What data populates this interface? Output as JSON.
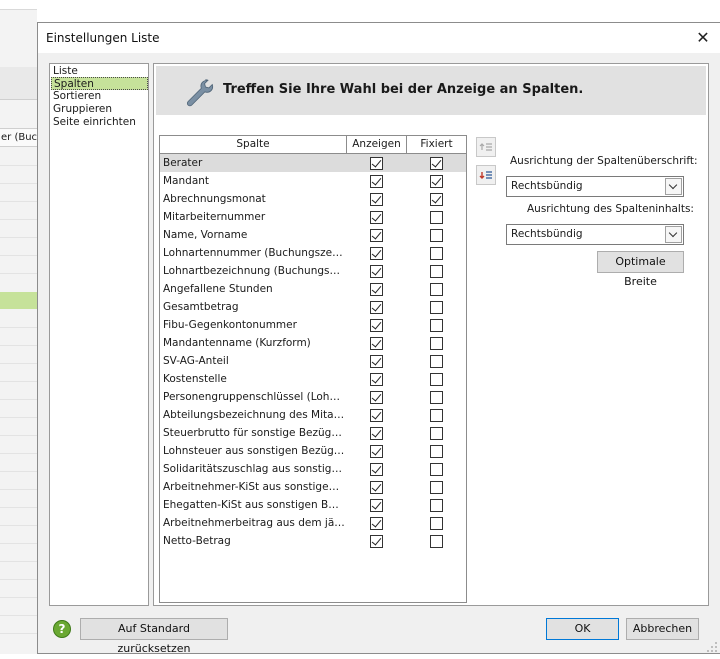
{
  "background": {
    "column_header_fragment": "er (Buc"
  },
  "dialog": {
    "title": "Einstellungen Liste",
    "close_glyph": "✕"
  },
  "nav": {
    "items": [
      {
        "label": "Liste",
        "selected": false
      },
      {
        "label": "Spalten",
        "selected": true
      },
      {
        "label": "Sortieren",
        "selected": false
      },
      {
        "label": "Gruppieren",
        "selected": false
      },
      {
        "label": "Seite einrichten",
        "selected": false
      }
    ]
  },
  "main": {
    "heading": "Treffen Sie Ihre Wahl bei der Anzeige an Spalten.",
    "icon": "wrench-icon"
  },
  "table": {
    "headers": {
      "spalte": "Spalte",
      "anzeigen": "Anzeigen",
      "fixiert": "Fixiert"
    },
    "rows": [
      {
        "name": "Berater",
        "anzeigen": true,
        "fixiert": true,
        "selected": true
      },
      {
        "name": "Mandant",
        "anzeigen": true,
        "fixiert": true
      },
      {
        "name": "Abrechnungsmonat",
        "anzeigen": true,
        "fixiert": true
      },
      {
        "name": "Mitarbeiternummer",
        "anzeigen": true,
        "fixiert": false
      },
      {
        "name": "Name, Vorname",
        "anzeigen": true,
        "fixiert": false
      },
      {
        "name": "Lohnartennummer (Buchungszeile)",
        "anzeigen": true,
        "fixiert": false
      },
      {
        "name": "Lohnartbezeichnung (Buchungszei...",
        "anzeigen": true,
        "fixiert": false
      },
      {
        "name": "Angefallene Stunden",
        "anzeigen": true,
        "fixiert": false
      },
      {
        "name": "Gesamtbetrag",
        "anzeigen": true,
        "fixiert": false
      },
      {
        "name": "Fibu-Gegenkontonummer",
        "anzeigen": true,
        "fixiert": false
      },
      {
        "name": "Mandantenname (Kurzform)",
        "anzeigen": true,
        "fixiert": false
      },
      {
        "name": "SV-AG-Anteil",
        "anzeigen": true,
        "fixiert": false
      },
      {
        "name": "Kostenstelle",
        "anzeigen": true,
        "fixiert": false
      },
      {
        "name": "Personengruppenschlüssel (Lohnk...",
        "anzeigen": true,
        "fixiert": false
      },
      {
        "name": "Abteilungsbezeichnung des Mitarb...",
        "anzeigen": true,
        "fixiert": false
      },
      {
        "name": "Steuerbrutto für sonstige Bezüge (...",
        "anzeigen": true,
        "fixiert": false
      },
      {
        "name": "Lohnsteuer aus sonstigen Bezüge...",
        "anzeigen": true,
        "fixiert": false
      },
      {
        "name": "Solidaritätszuschlag aus sonstigen...",
        "anzeigen": true,
        "fixiert": false
      },
      {
        "name": "Arbeitnehmer-KiSt aus sonstigen...",
        "anzeigen": true,
        "fixiert": false
      },
      {
        "name": "Ehegatten-KiSt aus sonstigen Bez...",
        "anzeigen": true,
        "fixiert": false
      },
      {
        "name": "Arbeitnehmerbeitrag aus dem jährl...",
        "anzeigen": true,
        "fixiert": false
      },
      {
        "name": "Netto-Betrag",
        "anzeigen": true,
        "fixiert": false
      }
    ]
  },
  "options": {
    "header_align_label": "Ausrichtung der Spaltenüberschrift:",
    "header_align_value": "Rechtsbündig",
    "content_align_label": "Ausrichtung des Spalteninhalts:",
    "content_align_value": "Rechtsbündig",
    "optimal_width_label": "Optimale Breite"
  },
  "footer": {
    "reset_label": "Auf Standard zurücksetzen",
    "ok_label": "OK",
    "cancel_label": "Abbrechen",
    "help_glyph": "?"
  },
  "colors": {
    "selection_green": "#c6e29a",
    "help_green": "#6aa832",
    "ok_border": "#0078d7"
  }
}
